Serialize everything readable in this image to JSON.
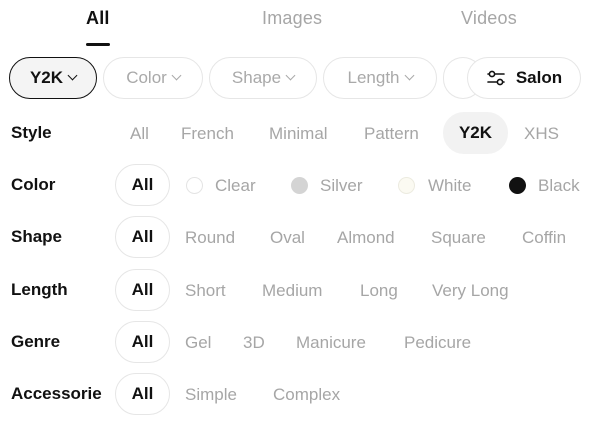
{
  "tabs": [
    "All",
    "Images",
    "Videos"
  ],
  "chips": {
    "y2k": "Y2K",
    "color": "Color",
    "shape": "Shape",
    "length": "Length",
    "salon": "Salon"
  },
  "rows": {
    "style": {
      "label": "Style",
      "options": [
        "All",
        "French",
        "Minimal",
        "Pattern",
        "Y2K",
        "XHS"
      ]
    },
    "color": {
      "label": "Color",
      "options": [
        "All",
        "Clear",
        "Silver",
        "White",
        "Black"
      ]
    },
    "shape": {
      "label": "Shape",
      "options": [
        "All",
        "Round",
        "Oval",
        "Almond",
        "Square",
        "Coffin"
      ]
    },
    "length": {
      "label": "Length",
      "options": [
        "All",
        "Short",
        "Medium",
        "Long",
        "Very Long"
      ]
    },
    "genre": {
      "label": "Genre",
      "options": [
        "All",
        "Gel",
        "3D",
        "Manicure",
        "Pedicure"
      ]
    },
    "accessories": {
      "label": "Accessorie",
      "options": [
        "All",
        "Simple",
        "Complex"
      ]
    }
  },
  "swatch_colors": {
    "clear": "#ffffff",
    "silver": "#d4d4d4",
    "white": "#fbfaf2",
    "black": "#111111"
  }
}
